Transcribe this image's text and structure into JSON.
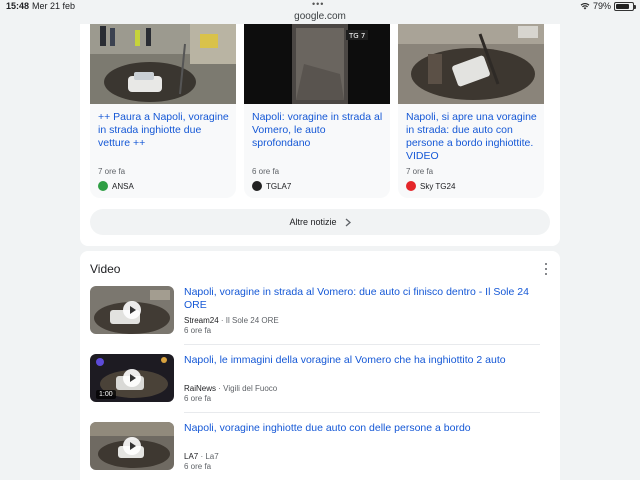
{
  "status": {
    "time": "15:48",
    "date": "Mer 21 feb",
    "dots": "•••",
    "battery": "79%",
    "battery_level": 0.79
  },
  "address": {
    "url": "google.com"
  },
  "news_cards": [
    {
      "title": "++ Paura a Napoli, voragine in strada inghiotte due vetture ++",
      "age": "7 ore fa",
      "source": "ANSA",
      "logo_color": "#2e9e44"
    },
    {
      "title": "Napoli: voragine in strada al Vomero, le auto sprofondano",
      "age": "6 ore fa",
      "source": "TGLA7",
      "logo_color": "#222222"
    },
    {
      "title": "Napoli, si apre una voragine in strada: due auto con persone a bordo inghiottite. VIDEO",
      "age": "7 ore fa",
      "source": "Sky TG24",
      "logo_color": "#e4262a"
    }
  ],
  "more_news": {
    "label": "Altre notizie",
    "icon": "chevron-right-icon"
  },
  "video_section": {
    "heading": "Video",
    "items": [
      {
        "title": "Napoli, voragine in strada al Vomero: due auto ci finisco dentro - Il Sole 24 ORE",
        "channel": "Stream24",
        "publisher": "Il Sole 24 ORE",
        "age": "6 ore fa",
        "duration": ""
      },
      {
        "title": "Napoli, le immagini della voragine al Vomero che ha inghiottito 2 auto",
        "channel": "RaiNews",
        "publisher": "Vigili del Fuoco",
        "age": "6 ore fa",
        "duration": "1:00"
      },
      {
        "title": "Napoli, voragine inghiotte due auto con delle persone a bordo",
        "channel": "LA7",
        "publisher": "La7",
        "age": "6 ore fa",
        "duration": ""
      }
    ]
  },
  "colors": {
    "link": "#1558d6",
    "page_bg": "#f1f3f4",
    "card_bg": "#f8f9fa"
  }
}
